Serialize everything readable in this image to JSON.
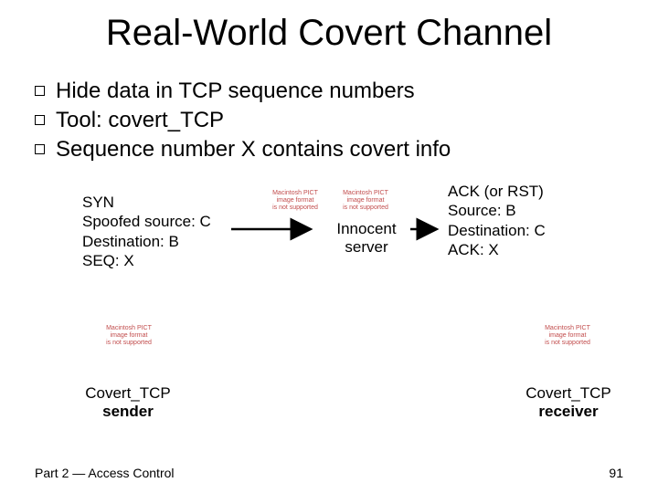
{
  "title": "Real-World Covert Channel",
  "bullets": [
    "Hide data in TCP sequence numbers",
    "Tool: covert_TCP",
    "Sequence number X contains covert info"
  ],
  "syn": {
    "l1": "SYN",
    "l2": "Spoofed source: C",
    "l3": "Destination: B",
    "l4": "SEQ: X"
  },
  "ack": {
    "l1": "ACK (or RST)",
    "l2": "Source: B",
    "l3": "Destination: C",
    "l4": "ACK: X"
  },
  "innocent": {
    "l1": "Innocent",
    "l2": "server"
  },
  "sender": {
    "l1": "Covert_TCP",
    "l2": "sender"
  },
  "receiver": {
    "l1": "Covert_TCP",
    "l2": "receiver"
  },
  "pict": {
    "l1": "Macintosh PICT",
    "l2": "image format",
    "l3": "is not supported"
  },
  "footer": {
    "left": "Part 2 — Access Control",
    "right": "91"
  }
}
